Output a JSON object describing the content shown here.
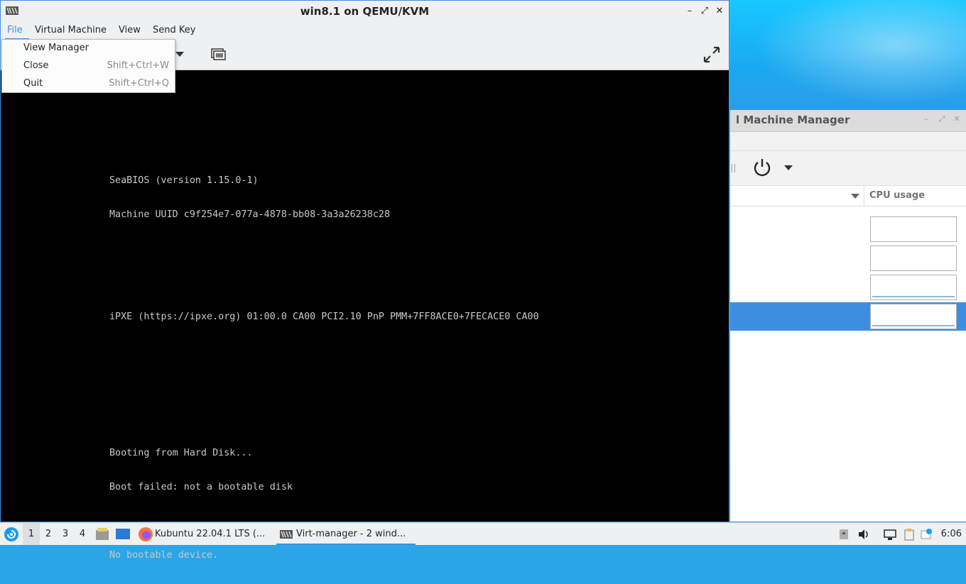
{
  "viewer": {
    "title": "win8.1 on QEMU/KVM",
    "menu": [
      "File",
      "Virtual Machine",
      "View",
      "Send Key"
    ],
    "window_buttons": {
      "minimize": "–",
      "maximize": "⤢",
      "close": "✕"
    }
  },
  "file_menu": {
    "items": [
      {
        "label": "View Manager",
        "shortcut": ""
      },
      {
        "label": "Close",
        "shortcut": "Shift+Ctrl+W"
      },
      {
        "label": "Quit",
        "shortcut": "Shift+Ctrl+Q"
      }
    ]
  },
  "console": {
    "lines": [
      "SeaBIOS (version 1.15.0-1)",
      "Machine UUID c9f254e7-077a-4878-bb08-3a3a26238c28",
      "",
      "",
      "iPXE (https://ipxe.org) 01:00.0 CA00 PCI2.10 PnP PMM+7FF8ACE0+7FECACE0 CA00",
      "",
      "",
      "",
      "Booting from Hard Disk...",
      "Boot failed: not a bootable disk",
      "",
      "No bootable device."
    ]
  },
  "manager": {
    "title": "l Machine Manager",
    "column_header": "CPU usage"
  },
  "taskbar": {
    "workspaces": [
      "1",
      "2",
      "3",
      "4"
    ],
    "tasks": [
      {
        "label": "Kubuntu 22.04.1 LTS (..."
      },
      {
        "label": "Virt-manager - 2 wind..."
      }
    ],
    "clock": "6:06"
  },
  "colors": {
    "accent": "#3d8ee0",
    "console_text": "#c8c8c8"
  }
}
